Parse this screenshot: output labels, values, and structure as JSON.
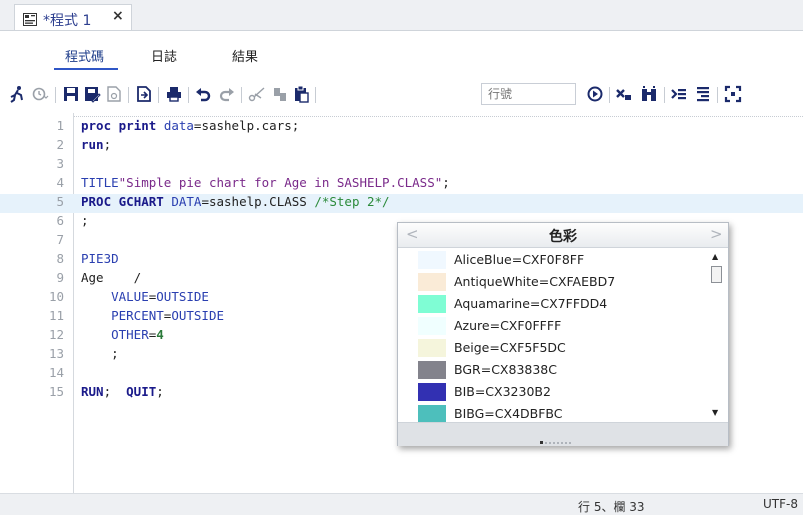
{
  "document_tab": {
    "title": "*程式 1",
    "close": "×"
  },
  "subtabs": [
    {
      "label": "程式碼",
      "active": true
    },
    {
      "label": "日誌",
      "active": false
    },
    {
      "label": "結果",
      "active": false
    }
  ],
  "toolbar": {
    "line_number_placeholder": "行號",
    "icons": [
      "run-icon",
      "history-icon",
      "save-icon",
      "save-as-icon",
      "print-preview-icon",
      "export-icon",
      "print-icon",
      "undo-icon",
      "redo-icon",
      "cut-icon",
      "copy-icon",
      "paste-icon",
      "go-to-line-icon",
      "clear-icon",
      "format-icon",
      "submit-selection-icon",
      "outline-icon",
      "maximize-icon"
    ]
  },
  "code": [
    {
      "n": "1",
      "segs": [
        {
          "c": "kw",
          "t": "proc"
        },
        {
          "t": " "
        },
        {
          "c": "kw",
          "t": "print"
        },
        {
          "t": " "
        },
        {
          "c": "bl",
          "t": "data"
        },
        {
          "t": "=sashelp.cars;"
        }
      ]
    },
    {
      "n": "2",
      "segs": [
        {
          "c": "kw",
          "t": "run"
        },
        {
          "t": ";"
        }
      ]
    },
    {
      "n": "3",
      "segs": []
    },
    {
      "n": "4",
      "segs": [
        {
          "c": "bl",
          "t": "TITLE"
        },
        {
          "c": "str",
          "t": "\"Simple pie chart for Age in SASHELP.CLASS\""
        },
        {
          "t": ";"
        }
      ]
    },
    {
      "n": "5",
      "highlight": true,
      "segs": [
        {
          "c": "kw",
          "t": "PROC"
        },
        {
          "t": " "
        },
        {
          "c": "kw",
          "t": "GCHART"
        },
        {
          "t": " "
        },
        {
          "c": "bl",
          "t": "DATA"
        },
        {
          "t": "=sashelp.CLASS "
        },
        {
          "c": "cm",
          "t": "/*Step 2*/"
        }
      ]
    },
    {
      "n": "6",
      "segs": [
        {
          "t": ";"
        }
      ]
    },
    {
      "n": "7",
      "segs": []
    },
    {
      "n": "8",
      "segs": [
        {
          "c": "bl",
          "t": "PIE3D"
        }
      ]
    },
    {
      "n": "9",
      "segs": [
        {
          "t": "Age    /"
        }
      ]
    },
    {
      "n": "10",
      "segs": [
        {
          "t": "    "
        },
        {
          "c": "bl",
          "t": "VALUE"
        },
        {
          "t": "="
        },
        {
          "c": "bl",
          "t": "OUTSIDE"
        }
      ]
    },
    {
      "n": "11",
      "segs": [
        {
          "t": "    "
        },
        {
          "c": "bl",
          "t": "PERCENT"
        },
        {
          "t": "="
        },
        {
          "c": "bl",
          "t": "OUTSIDE"
        }
      ]
    },
    {
      "n": "12",
      "segs": [
        {
          "t": "    "
        },
        {
          "c": "bl",
          "t": "OTHER"
        },
        {
          "t": "="
        },
        {
          "c": "num-g",
          "t": "4"
        }
      ]
    },
    {
      "n": "13",
      "segs": [
        {
          "t": "    ;"
        }
      ]
    },
    {
      "n": "14",
      "segs": []
    },
    {
      "n": "15",
      "segs": [
        {
          "c": "kw",
          "t": "RUN"
        },
        {
          "t": ";  "
        },
        {
          "c": "kw",
          "t": "QUIT"
        },
        {
          "t": ";"
        }
      ]
    }
  ],
  "color_popup": {
    "title": "色彩",
    "prev": "<",
    "next": ">",
    "items": [
      {
        "label": "AliceBlue=CXF0F8FF",
        "color": "#F0F8FF"
      },
      {
        "label": "AntiqueWhite=CXFAEBD7",
        "color": "#FAEBD7"
      },
      {
        "label": "Aquamarine=CX7FFDD4",
        "color": "#7FFDD4"
      },
      {
        "label": "Azure=CXF0FFFF",
        "color": "#F0FFFF"
      },
      {
        "label": "Beige=CXF5F5DC",
        "color": "#F5F5DC"
      },
      {
        "label": "BGR=CX83838C",
        "color": "#83838C"
      },
      {
        "label": "BIB=CX3230B2",
        "color": "#3230B2"
      },
      {
        "label": "BIBG=CX4DBFBC",
        "color": "#4DBFBC"
      }
    ]
  },
  "status": {
    "position": "行 5、欄 33",
    "encoding": "UTF-8"
  }
}
